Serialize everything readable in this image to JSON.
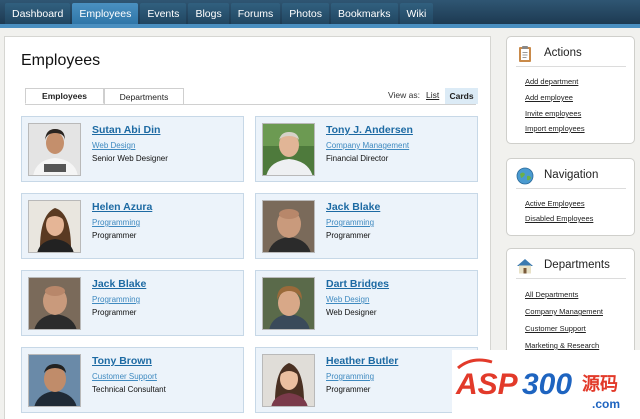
{
  "nav": {
    "tabs": [
      {
        "label": "Dashboard",
        "active": false
      },
      {
        "label": "Employees",
        "active": true
      },
      {
        "label": "Events",
        "active": false
      },
      {
        "label": "Blogs",
        "active": false
      },
      {
        "label": "Forums",
        "active": false
      },
      {
        "label": "Photos",
        "active": false
      },
      {
        "label": "Bookmarks",
        "active": false
      },
      {
        "label": "Wiki",
        "active": false
      }
    ]
  },
  "main": {
    "title": "Employees",
    "tabs": [
      "Employees",
      "Departments"
    ],
    "view_as_label": "View as:",
    "view_list": "List",
    "view_cards": "Cards"
  },
  "employees": [
    {
      "name": "Sutan Abi Din",
      "department": "Web Design",
      "title": "Senior Web Designer"
    },
    {
      "name": "Tony J. Andersen",
      "department": "Company Management",
      "title": "Financial Director"
    },
    {
      "name": "Helen Azura",
      "department": "Programming",
      "title": "Programmer"
    },
    {
      "name": "Jack Blake",
      "department": "Programming",
      "title": "Programmer"
    },
    {
      "name": "Jack Blake",
      "department": "Programming",
      "title": "Programmer"
    },
    {
      "name": "Dart Bridges",
      "department": "Web Design",
      "title": "Web Designer"
    },
    {
      "name": "Tony Brown",
      "department": "Customer Support",
      "title": "Technical Consultant"
    },
    {
      "name": "Heather Butler",
      "department": "Programming",
      "title": "Programmer"
    }
  ],
  "sidebar": {
    "actions": {
      "title": "Actions",
      "icon": "clipboard-icon",
      "links": [
        "Add department",
        "Add employee",
        "Invite employees",
        "Import employees"
      ]
    },
    "navigation": {
      "title": "Navigation",
      "icon": "globe-icon",
      "links": [
        "Active Employees",
        "Disabled Employees"
      ]
    },
    "departments": {
      "title": "Departments",
      "icon": "house-icon",
      "links": [
        "All Departments",
        "Company Management",
        "Customer Support",
        "Marketing & Research"
      ]
    }
  },
  "watermark": {
    "text": "ASP300",
    "cn": "源码",
    "suffix": ".com"
  },
  "colors": {
    "nav_bg": "#1d3a52",
    "nav_active": "#3a84b8",
    "link": "#1d6aa3",
    "card_bg": "#ecf3fa"
  }
}
